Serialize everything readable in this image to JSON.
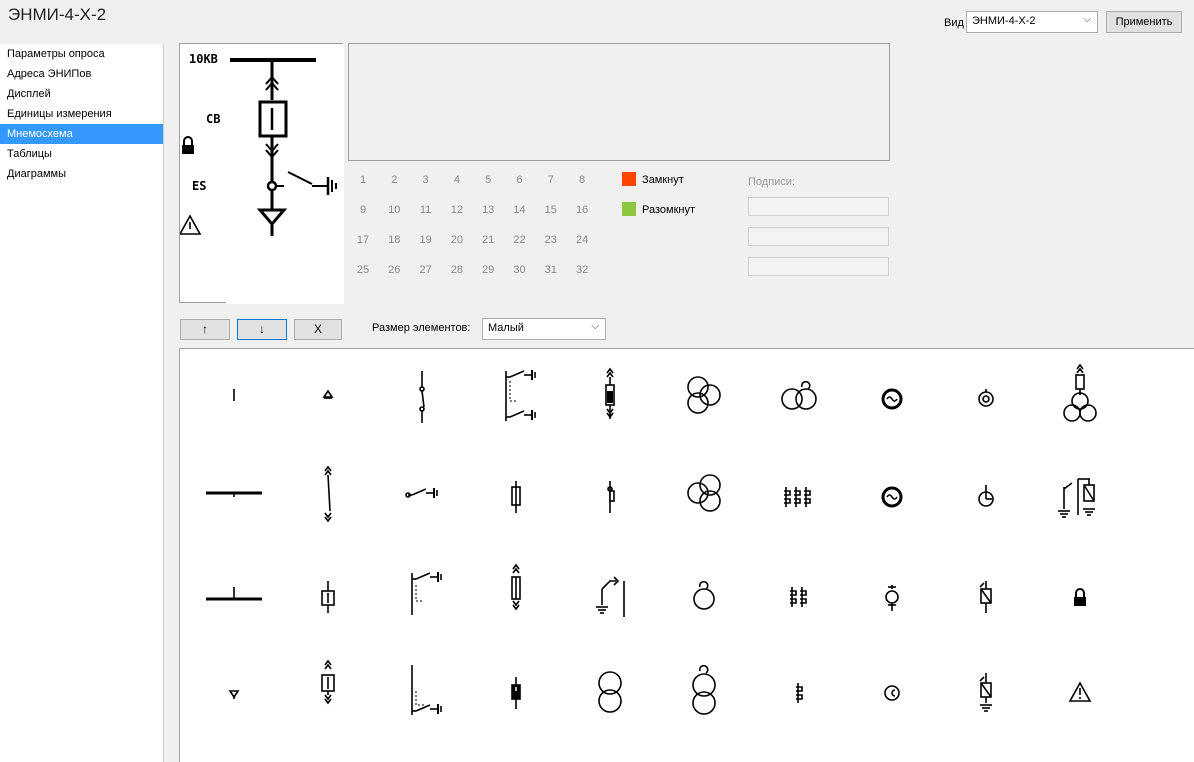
{
  "window": {
    "title": "ЭНМИ-4-Х-2"
  },
  "toolbar": {
    "view_label": "Вид",
    "view_value": "ЭНМИ-4-Х-2",
    "apply_label": "Применить"
  },
  "sidebar": {
    "items": [
      {
        "label": "Параметры опроса"
      },
      {
        "label": "Адреса ЭНИПов"
      },
      {
        "label": "Дисплей"
      },
      {
        "label": "Единицы измерения"
      },
      {
        "label": "Мнемосхема"
      },
      {
        "label": "Таблицы"
      },
      {
        "label": "Диаграммы"
      }
    ],
    "selected_index": 4
  },
  "preview": {
    "bus_label": "10КВ",
    "cb_label": "CB",
    "es_label": "ES"
  },
  "numbers": [
    "1",
    "2",
    "3",
    "4",
    "5",
    "6",
    "7",
    "8",
    "9",
    "10",
    "11",
    "12",
    "13",
    "14",
    "15",
    "16",
    "17",
    "18",
    "19",
    "20",
    "21",
    "22",
    "23",
    "24",
    "25",
    "26",
    "27",
    "28",
    "29",
    "30",
    "31",
    "32"
  ],
  "legend": {
    "closed_label": "Замкнут",
    "closed_color": "#ff4500",
    "open_label": "Разомкнут",
    "open_color": "#8dc63f"
  },
  "captions": {
    "label": "Подписи:",
    "values": [
      "",
      "",
      ""
    ]
  },
  "controls": {
    "up_label": "↑",
    "down_label": "↓",
    "delete_label": "X",
    "size_label": "Размер элементов:",
    "size_value": "Малый"
  },
  "palette": {
    "icons": [
      "busbar-stub-icon",
      "node-small-icon",
      "disconnector-vertical-icon",
      "switch-double-grounding-icon",
      "breaker-cart-icon",
      "transformer-three-winding-icon",
      "transformer-horizontal-icon",
      "generator-icon",
      "current-source-icon",
      "transformer-group-icon",
      "busbar-long-icon",
      "withdrawable-disconnector-icon",
      "grounding-switch-horizontal-icon",
      "fuse-icon",
      "disconnector-fuse-icon",
      "transformer-three-winding-alt-icon",
      "current-transformer-triple-icon",
      "generator-alt-icon",
      "reactor-icon",
      "surge-arrester-group-icon",
      "busbar-tee-icon",
      "breaker-small-icon",
      "switch-grounding-icon",
      "cart-fuse-icon",
      "ground-switch-icon",
      "winding-icon",
      "current-transformer-double-icon",
      "sensor-icon",
      "arrester-icon",
      "lock-icon",
      "node-down-icon",
      "breaker-cart-full-icon",
      "switch-grounding-bottom-icon",
      "breaker-filled-icon",
      "transformer-two-winding-icon",
      "transformer-tap-icon",
      "current-transformer-icon",
      "meter-icon",
      "arrester-ground-icon",
      "warning-icon"
    ]
  }
}
